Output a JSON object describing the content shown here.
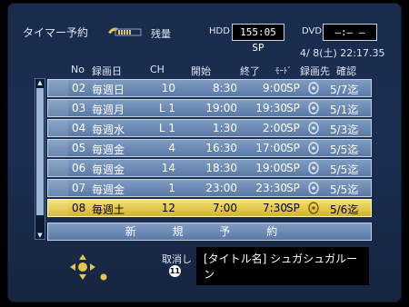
{
  "header": {
    "title": "タイマー予約",
    "remain_label": "残量",
    "hdd_label": "HDD",
    "hdd_value": "155:05 SP",
    "dvd_label": "DVD",
    "dvd_value": "‒:‒ ‒",
    "datetime": "4/ 8(土) 22:17.35"
  },
  "columns": {
    "no": "No",
    "day": "録画日",
    "ch": "CH",
    "start": "開始",
    "end": "終了",
    "mode": "ﾓｰﾄﾞ",
    "dest": "録画先",
    "confirm": "確認"
  },
  "rows": [
    {
      "no": "02",
      "day": "毎週日",
      "ch": "10",
      "start": "8:30",
      "end": "9:00",
      "mode": "SP",
      "dest": "hdd-icon",
      "confirm": "5/7迄",
      "selected": false
    },
    {
      "no": "03",
      "day": "毎週月",
      "ch": "L 1",
      "start": "19:00",
      "end": "19:30",
      "mode": "SP",
      "dest": "hdd-icon",
      "confirm": "5/1迄",
      "selected": false
    },
    {
      "no": "04",
      "day": "毎週水",
      "ch": "L 1",
      "start": "1:30",
      "end": "2:00",
      "mode": "SP",
      "dest": "hdd-icon",
      "confirm": "5/3迄",
      "selected": false
    },
    {
      "no": "05",
      "day": "毎週金",
      "ch": "4",
      "start": "16:30",
      "end": "17:00",
      "mode": "SP",
      "dest": "hdd-icon",
      "confirm": "5/5迄",
      "selected": false
    },
    {
      "no": "06",
      "day": "毎週金",
      "ch": "14",
      "start": "18:30",
      "end": "19:00",
      "mode": "SP",
      "dest": "hdd-icon",
      "confirm": "5/5迄",
      "selected": false
    },
    {
      "no": "07",
      "day": "毎週金",
      "ch": "1",
      "start": "23:00",
      "end": "23:30",
      "mode": "SP",
      "dest": "hdd-icon",
      "confirm": "5/5迄",
      "selected": false
    },
    {
      "no": "08",
      "day": "毎週土",
      "ch": "12",
      "start": "7:00",
      "end": "7:30",
      "mode": "SP",
      "dest": "hdd-icon",
      "confirm": "5/6迄",
      "selected": true
    }
  ],
  "new_button": "新 規 予 約",
  "footer": {
    "cancel_label": "取消し",
    "cancel_key": "11",
    "info_text": "[タイトル名]  シュガシュガルーン"
  },
  "colors": {
    "row_bg": "#6d8bb4",
    "selected_bg": "#e6cb4a",
    "panel_bg": "#1b2e52"
  }
}
